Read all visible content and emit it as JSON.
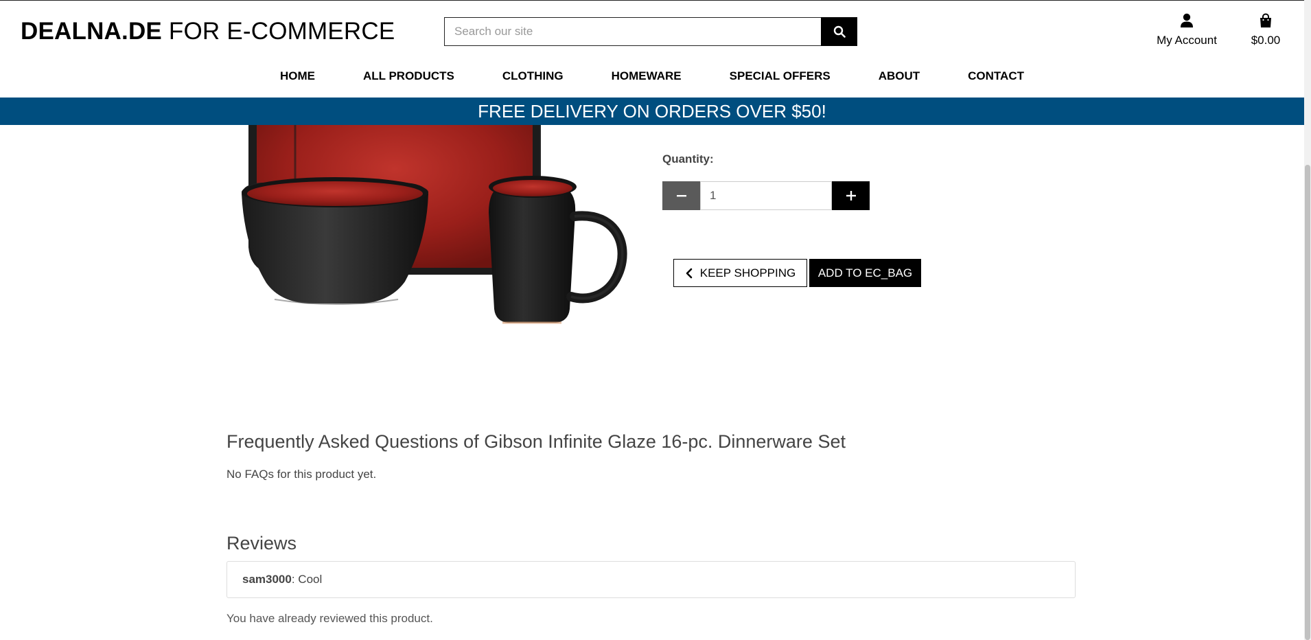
{
  "header": {
    "logo_bold": "DEALNA.DE",
    "logo_light": "FOR E-COMMERCE",
    "search_placeholder": "Search our site",
    "account_label": "My Account",
    "bag_total": "$0.00"
  },
  "nav": {
    "items": [
      {
        "label": "HOME"
      },
      {
        "label": "ALL PRODUCTS"
      },
      {
        "label": "CLOTHING"
      },
      {
        "label": "HOMEWARE"
      },
      {
        "label": "SPECIAL OFFERS"
      },
      {
        "label": "ABOUT"
      },
      {
        "label": "CONTACT"
      }
    ]
  },
  "promo": {
    "text": "FREE DELIVERY ON ORDERS OVER $50!",
    "background": "#004e7f"
  },
  "product": {
    "quantity_label": "Quantity:",
    "quantity_value": "1",
    "keep_shopping_label": "KEEP SHOPPING",
    "add_to_bag_label": "ADD TO EC_BAG"
  },
  "faq": {
    "title": "Frequently Asked Questions of Gibson Infinite Glaze 16-pc. Dinnerware Set",
    "empty_text": "No FAQs for this product yet."
  },
  "reviews": {
    "title": "Reviews",
    "items": [
      {
        "author": "sam3000",
        "text": ": Cool"
      }
    ],
    "already_reviewed": "You have already reviewed this product."
  },
  "icons": {
    "search": "search-icon",
    "account": "user-icon",
    "bag": "shopping-bag-icon",
    "minus": "minus-icon",
    "plus": "plus-icon",
    "back": "chevron-left-icon"
  }
}
